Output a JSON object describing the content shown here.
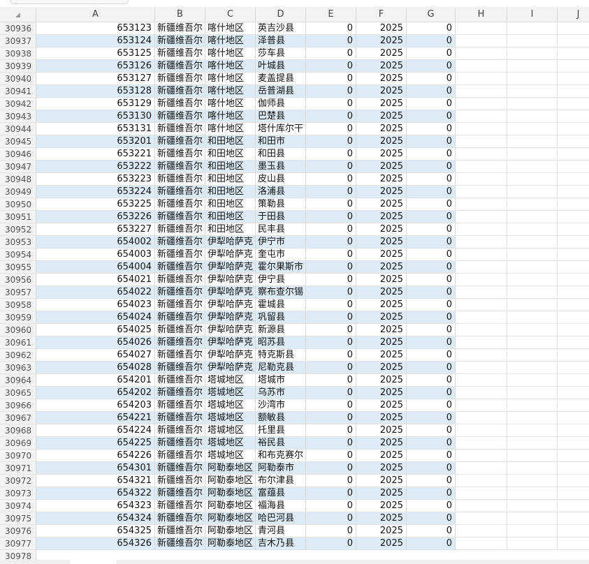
{
  "columns": [
    "A",
    "B",
    "C",
    "D",
    "E",
    "F",
    "G",
    "H",
    "I",
    "J"
  ],
  "rows": [
    {
      "row": "30936",
      "A": "653123",
      "B": "新疆维吾尔",
      "C": "喀什地区",
      "D": "英吉沙县",
      "E": "0",
      "F": "2025",
      "G": "0"
    },
    {
      "row": "30937",
      "A": "653124",
      "B": "新疆维吾尔",
      "C": "喀什地区",
      "D": "泽普县",
      "E": "0",
      "F": "2025",
      "G": "0"
    },
    {
      "row": "30938",
      "A": "653125",
      "B": "新疆维吾尔",
      "C": "喀什地区",
      "D": "莎车县",
      "E": "0",
      "F": "2025",
      "G": "0"
    },
    {
      "row": "30939",
      "A": "653126",
      "B": "新疆维吾尔",
      "C": "喀什地区",
      "D": "叶城县",
      "E": "0",
      "F": "2025",
      "G": "0"
    },
    {
      "row": "30940",
      "A": "653127",
      "B": "新疆维吾尔",
      "C": "喀什地区",
      "D": "麦盖提县",
      "E": "0",
      "F": "2025",
      "G": "0"
    },
    {
      "row": "30941",
      "A": "653128",
      "B": "新疆维吾尔",
      "C": "喀什地区",
      "D": "岳普湖县",
      "E": "0",
      "F": "2025",
      "G": "0"
    },
    {
      "row": "30942",
      "A": "653129",
      "B": "新疆维吾尔",
      "C": "喀什地区",
      "D": "伽师县",
      "E": "0",
      "F": "2025",
      "G": "0"
    },
    {
      "row": "30943",
      "A": "653130",
      "B": "新疆维吾尔",
      "C": "喀什地区",
      "D": "巴楚县",
      "E": "0",
      "F": "2025",
      "G": "0"
    },
    {
      "row": "30944",
      "A": "653131",
      "B": "新疆维吾尔",
      "C": "喀什地区",
      "D": "塔什库尔干",
      "E": "0",
      "F": "2025",
      "G": "0"
    },
    {
      "row": "30945",
      "A": "653201",
      "B": "新疆维吾尔",
      "C": "和田地区",
      "D": "和田市",
      "E": "0",
      "F": "2025",
      "G": "0"
    },
    {
      "row": "30946",
      "A": "653221",
      "B": "新疆维吾尔",
      "C": "和田地区",
      "D": "和田县",
      "E": "0",
      "F": "2025",
      "G": "0"
    },
    {
      "row": "30947",
      "A": "653222",
      "B": "新疆维吾尔",
      "C": "和田地区",
      "D": "墨玉县",
      "E": "0",
      "F": "2025",
      "G": "0"
    },
    {
      "row": "30948",
      "A": "653223",
      "B": "新疆维吾尔",
      "C": "和田地区",
      "D": "皮山县",
      "E": "0",
      "F": "2025",
      "G": "0"
    },
    {
      "row": "30949",
      "A": "653224",
      "B": "新疆维吾尔",
      "C": "和田地区",
      "D": "洛浦县",
      "E": "0",
      "F": "2025",
      "G": "0"
    },
    {
      "row": "30950",
      "A": "653225",
      "B": "新疆维吾尔",
      "C": "和田地区",
      "D": "策勒县",
      "E": "0",
      "F": "2025",
      "G": "0"
    },
    {
      "row": "30951",
      "A": "653226",
      "B": "新疆维吾尔",
      "C": "和田地区",
      "D": "于田县",
      "E": "0",
      "F": "2025",
      "G": "0"
    },
    {
      "row": "30952",
      "A": "653227",
      "B": "新疆维吾尔",
      "C": "和田地区",
      "D": "民丰县",
      "E": "0",
      "F": "2025",
      "G": "0"
    },
    {
      "row": "30953",
      "A": "654002",
      "B": "新疆维吾尔",
      "C": "伊犁哈萨克",
      "D": "伊宁市",
      "E": "0",
      "F": "2025",
      "G": "0"
    },
    {
      "row": "30954",
      "A": "654003",
      "B": "新疆维吾尔",
      "C": "伊犁哈萨克",
      "D": "奎屯市",
      "E": "0",
      "F": "2025",
      "G": "0"
    },
    {
      "row": "30955",
      "A": "654004",
      "B": "新疆维吾尔",
      "C": "伊犁哈萨克",
      "D": "霍尔果斯市",
      "E": "0",
      "F": "2025",
      "G": "0"
    },
    {
      "row": "30956",
      "A": "654021",
      "B": "新疆维吾尔",
      "C": "伊犁哈萨克",
      "D": "伊宁县",
      "E": "0",
      "F": "2025",
      "G": "0"
    },
    {
      "row": "30957",
      "A": "654022",
      "B": "新疆维吾尔",
      "C": "伊犁哈萨克",
      "D": "察布查尔锡",
      "E": "0",
      "F": "2025",
      "G": "0"
    },
    {
      "row": "30958",
      "A": "654023",
      "B": "新疆维吾尔",
      "C": "伊犁哈萨克",
      "D": "霍城县",
      "E": "0",
      "F": "2025",
      "G": "0"
    },
    {
      "row": "30959",
      "A": "654024",
      "B": "新疆维吾尔",
      "C": "伊犁哈萨克",
      "D": "巩留县",
      "E": "0",
      "F": "2025",
      "G": "0"
    },
    {
      "row": "30960",
      "A": "654025",
      "B": "新疆维吾尔",
      "C": "伊犁哈萨克",
      "D": "新源县",
      "E": "0",
      "F": "2025",
      "G": "0"
    },
    {
      "row": "30961",
      "A": "654026",
      "B": "新疆维吾尔",
      "C": "伊犁哈萨克",
      "D": "昭苏县",
      "E": "0",
      "F": "2025",
      "G": "0"
    },
    {
      "row": "30962",
      "A": "654027",
      "B": "新疆维吾尔",
      "C": "伊犁哈萨克",
      "D": "特克斯县",
      "E": "0",
      "F": "2025",
      "G": "0"
    },
    {
      "row": "30963",
      "A": "654028",
      "B": "新疆维吾尔",
      "C": "伊犁哈萨克",
      "D": "尼勒克县",
      "E": "0",
      "F": "2025",
      "G": "0"
    },
    {
      "row": "30964",
      "A": "654201",
      "B": "新疆维吾尔",
      "C": "塔城地区",
      "D": "塔城市",
      "E": "0",
      "F": "2025",
      "G": "0"
    },
    {
      "row": "30965",
      "A": "654202",
      "B": "新疆维吾尔",
      "C": "塔城地区",
      "D": "乌苏市",
      "E": "0",
      "F": "2025",
      "G": "0"
    },
    {
      "row": "30966",
      "A": "654203",
      "B": "新疆维吾尔",
      "C": "塔城地区",
      "D": "沙湾市",
      "E": "0",
      "F": "2025",
      "G": "0"
    },
    {
      "row": "30967",
      "A": "654221",
      "B": "新疆维吾尔",
      "C": "塔城地区",
      "D": "额敏县",
      "E": "0",
      "F": "2025",
      "G": "0"
    },
    {
      "row": "30968",
      "A": "654224",
      "B": "新疆维吾尔",
      "C": "塔城地区",
      "D": "托里县",
      "E": "0",
      "F": "2025",
      "G": "0"
    },
    {
      "row": "30969",
      "A": "654225",
      "B": "新疆维吾尔",
      "C": "塔城地区",
      "D": "裕民县",
      "E": "0",
      "F": "2025",
      "G": "0"
    },
    {
      "row": "30970",
      "A": "654226",
      "B": "新疆维吾尔",
      "C": "塔城地区",
      "D": "和布克赛尔",
      "E": "0",
      "F": "2025",
      "G": "0"
    },
    {
      "row": "30971",
      "A": "654301",
      "B": "新疆维吾尔",
      "C": "阿勒泰地区",
      "D": "阿勒泰市",
      "E": "0",
      "F": "2025",
      "G": "0"
    },
    {
      "row": "30972",
      "A": "654321",
      "B": "新疆维吾尔",
      "C": "阿勒泰地区",
      "D": "布尔津县",
      "E": "0",
      "F": "2025",
      "G": "0"
    },
    {
      "row": "30973",
      "A": "654322",
      "B": "新疆维吾尔",
      "C": "阿勒泰地区",
      "D": "富蕴县",
      "E": "0",
      "F": "2025",
      "G": "0"
    },
    {
      "row": "30974",
      "A": "654323",
      "B": "新疆维吾尔",
      "C": "阿勒泰地区",
      "D": "福海县",
      "E": "0",
      "F": "2025",
      "G": "0"
    },
    {
      "row": "30975",
      "A": "654324",
      "B": "新疆维吾尔",
      "C": "阿勒泰地区",
      "D": "哈巴河县",
      "E": "0",
      "F": "2025",
      "G": "0"
    },
    {
      "row": "30976",
      "A": "654325",
      "B": "新疆维吾尔",
      "C": "阿勒泰地区",
      "D": "青河县",
      "E": "0",
      "F": "2025",
      "G": "0"
    },
    {
      "row": "30977",
      "A": "654326",
      "B": "新疆维吾尔",
      "C": "阿勒泰地区",
      "D": "吉木乃县",
      "E": "0",
      "F": "2025",
      "G": "0"
    }
  ],
  "last_row": "30978",
  "colors": {
    "band": "#ddebf7",
    "header_bg": "#f3f3f3",
    "grid": "#d9d9d9"
  }
}
